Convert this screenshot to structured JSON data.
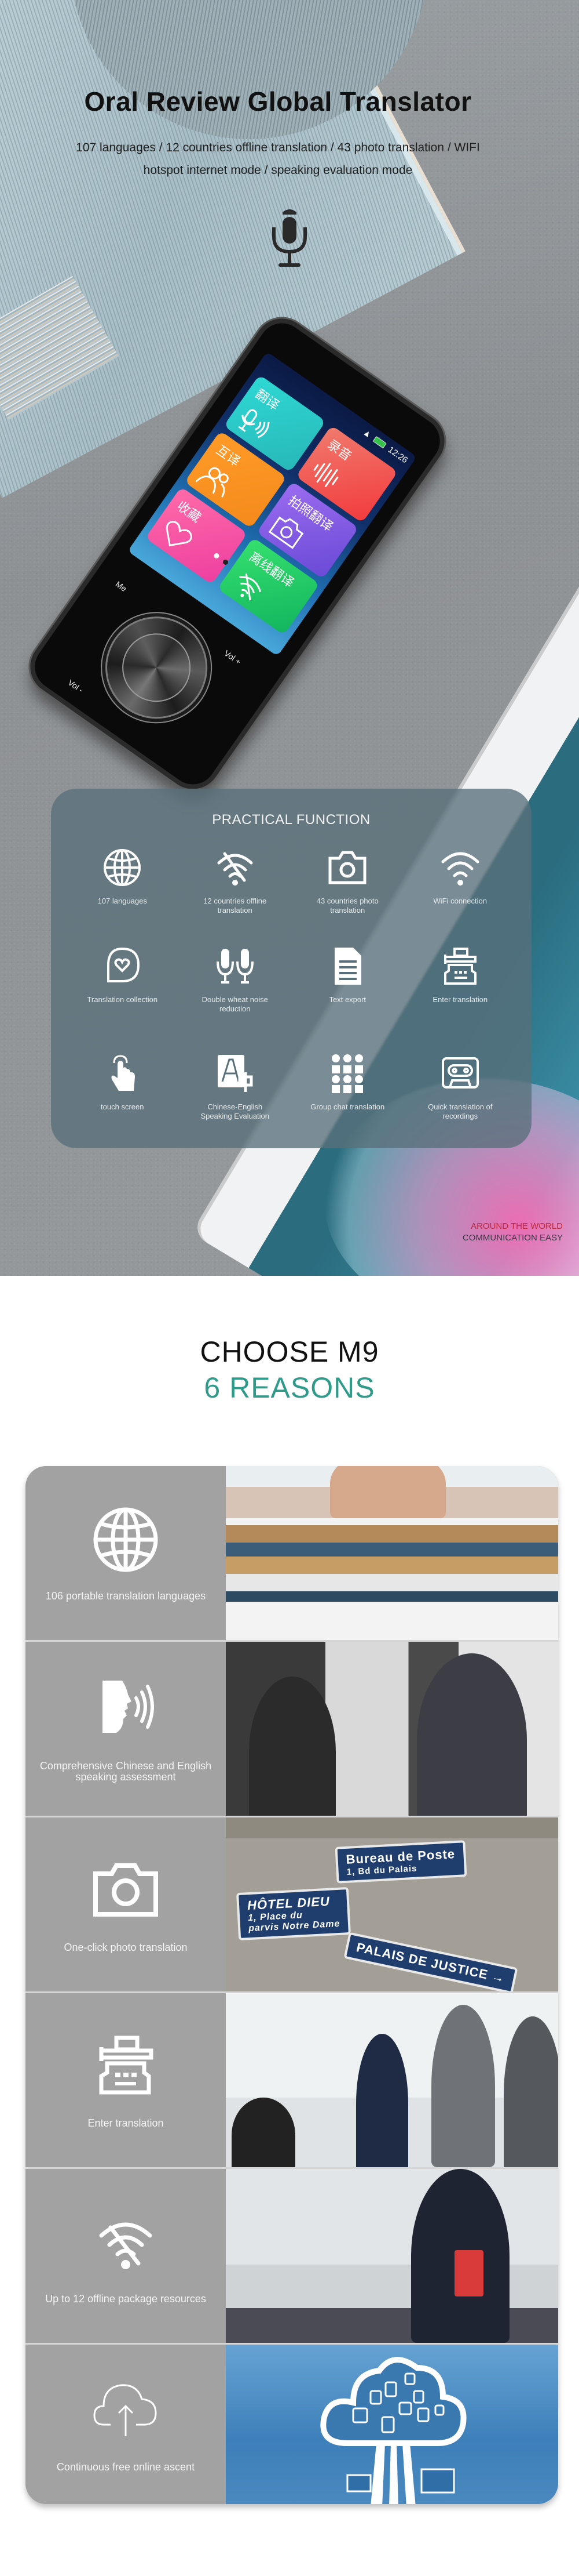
{
  "hero": {
    "title": "Oral Review Global Translator",
    "subtitle": "107 languages / 12 countries offline translation / 43 photo translation / WIFI hotspot internet mode / speaking evaluation mode",
    "icon": "microphone-icon",
    "device": {
      "status_time": "12:26",
      "tiles": [
        {
          "label": "翻译",
          "icon": "mic-sound-icon",
          "color": "#2ed8d4"
        },
        {
          "label": "录音",
          "icon": "sound-wave-icon",
          "color": "#f23b3d"
        },
        {
          "label": "互译",
          "icon": "two-people-icon",
          "color": "#ff9b28"
        },
        {
          "label": "拍照翻译",
          "icon": "camera-icon",
          "color": "#6a4ad6"
        },
        {
          "label": "收藏",
          "icon": "heart-icon",
          "color": "#ed3fa0"
        },
        {
          "label": "离线翻译",
          "icon": "wifi-off-icon",
          "color": "#12b55f"
        }
      ],
      "button_labels": {
        "menu": "Me",
        "vol_up": "Vol +",
        "vol_down": "Vol -"
      }
    },
    "tagline": {
      "line1": "AROUND THE WORLD",
      "line2": "COMMUNICATION EASY"
    }
  },
  "practical_function": {
    "title": "PRACTICAL FUNCTION",
    "items": [
      {
        "label": "107 languages",
        "icon": "globe-icon"
      },
      {
        "label": "12 countries offline translation",
        "icon": "wifi-off-icon"
      },
      {
        "label": "43 countries photo translation",
        "icon": "camera-icon"
      },
      {
        "label": "WiFi connection",
        "icon": "wifi-icon"
      },
      {
        "label": "Translation collection",
        "icon": "heart-bubble-icon"
      },
      {
        "label": "Double wheat noise reduction",
        "icon": "dual-microphone-icon"
      },
      {
        "label": "Text export",
        "icon": "document-icon"
      },
      {
        "label": "Enter translation",
        "icon": "typewriter-icon"
      },
      {
        "label": "touch screen",
        "icon": "touch-hand-icon"
      },
      {
        "label": "Chinese-English Speaking Evaluation",
        "icon": "language-translate-icon"
      },
      {
        "label": "Group chat translation",
        "icon": "group-grid-icon"
      },
      {
        "label": "Quick translation of recordings",
        "icon": "cassette-icon"
      }
    ]
  },
  "reasons": {
    "title": "CHOOSE M9",
    "subtitle": "6 REASONS",
    "accent_color": "#2f9b8a",
    "items": [
      {
        "label": "106 portable translation languages",
        "icon": "globe-icon",
        "photo": "student-with-books"
      },
      {
        "label": "Comprehensive Chinese and English speaking assessment",
        "icon": "speaking-head-icon",
        "photo": "business-conversation"
      },
      {
        "label": "One-click photo translation",
        "icon": "camera-icon",
        "photo": "street-signs"
      },
      {
        "label": "Enter translation",
        "icon": "typewriter-icon",
        "photo": "office-handshake"
      },
      {
        "label": "Up to 12 offline package resources",
        "icon": "wifi-off-icon",
        "photo": "flight-attendant"
      },
      {
        "label": "Continuous free online ascent",
        "icon": "cloud-upload-icon",
        "photo": "cloud-network"
      }
    ],
    "signs": {
      "sign1_line1": "Bureau de Poste",
      "sign1_line2": "1, Bd du Palais",
      "sign2_line1": "HÔTEL DIEU",
      "sign2_line2": "1, Place du",
      "sign2_line3": "parvis Notre Dame",
      "sign3": "PALAIS DE JUSTICE"
    }
  }
}
